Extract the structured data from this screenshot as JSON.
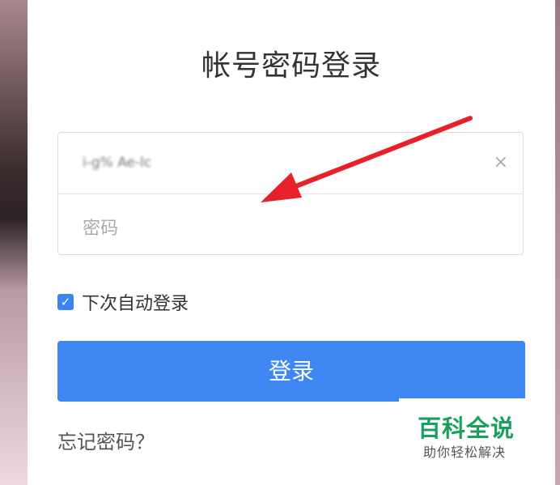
{
  "page_title": "帐号密码登录",
  "form": {
    "username_value": "i-g% Ae-lc",
    "password_placeholder": "密码",
    "clear_symbol": "×",
    "remember_label": "下次自动登录",
    "remember_checked": true,
    "login_button_label": "登录",
    "forgot_link": "忘记密码？"
  },
  "watermark": {
    "title": "百科全说",
    "subtitle": "助你轻松解决"
  },
  "colors": {
    "primary": "#3f88f3",
    "watermark_green": "#1aa05c",
    "arrow_red": "#e8202a"
  },
  "icons": [
    "clear-icon",
    "checkbox-checked-icon",
    "red-arrow-annotation"
  ]
}
